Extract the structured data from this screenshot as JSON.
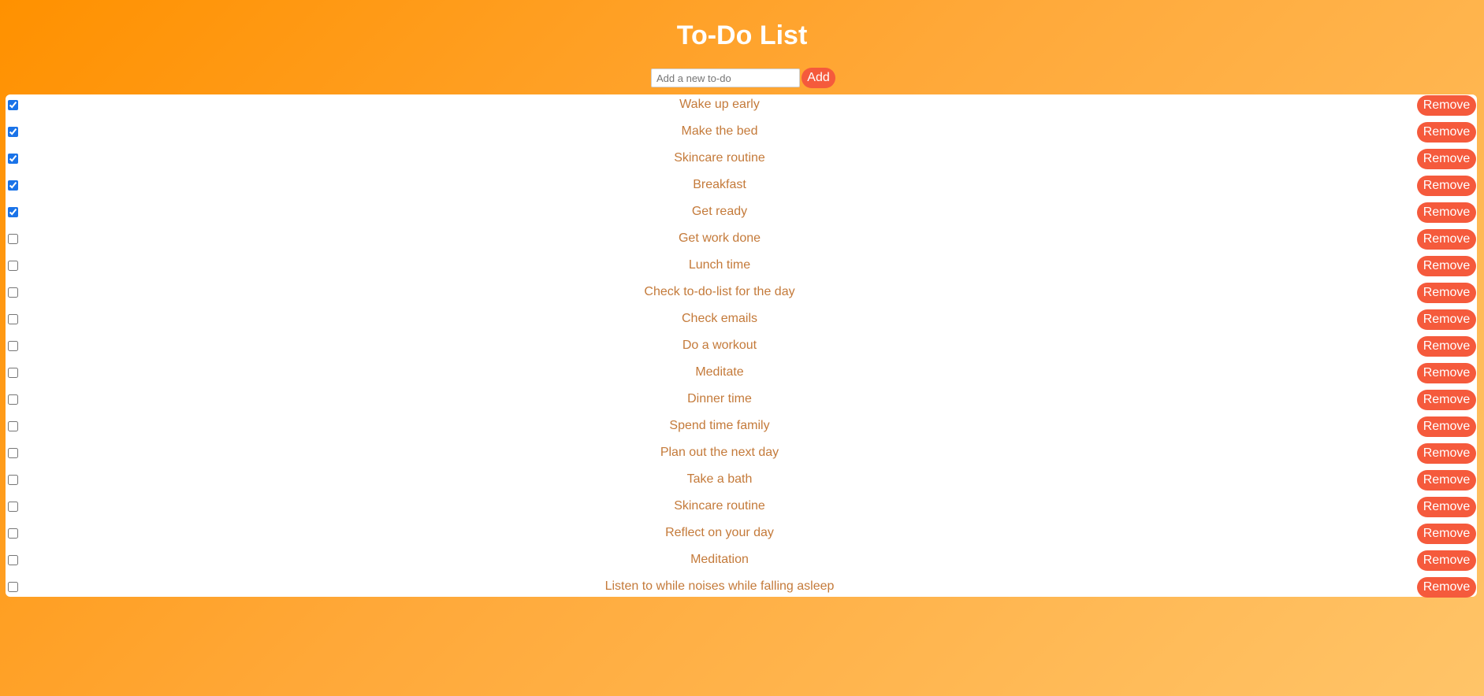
{
  "app": {
    "title": "To-Do List"
  },
  "add_form": {
    "placeholder": "Add a new to-do",
    "value": "",
    "button_label": "Add"
  },
  "todos": [
    {
      "text": "Wake up early",
      "done": true,
      "remove_label": "Remove"
    },
    {
      "text": "Make the bed",
      "done": true,
      "remove_label": "Remove"
    },
    {
      "text": "Skincare routine",
      "done": true,
      "remove_label": "Remove"
    },
    {
      "text": "Breakfast",
      "done": true,
      "remove_label": "Remove"
    },
    {
      "text": "Get ready",
      "done": true,
      "remove_label": "Remove"
    },
    {
      "text": "Get work done",
      "done": false,
      "remove_label": "Remove"
    },
    {
      "text": "Lunch time",
      "done": false,
      "remove_label": "Remove"
    },
    {
      "text": "Check to-do-list for the day",
      "done": false,
      "remove_label": "Remove"
    },
    {
      "text": "Check emails",
      "done": false,
      "remove_label": "Remove"
    },
    {
      "text": "Do a workout",
      "done": false,
      "remove_label": "Remove"
    },
    {
      "text": "Meditate",
      "done": false,
      "remove_label": "Remove"
    },
    {
      "text": "Dinner time",
      "done": false,
      "remove_label": "Remove"
    },
    {
      "text": "Spend time family",
      "done": false,
      "remove_label": "Remove"
    },
    {
      "text": "Plan out the next day",
      "done": false,
      "remove_label": "Remove"
    },
    {
      "text": "Take a bath",
      "done": false,
      "remove_label": "Remove"
    },
    {
      "text": "Skincare routine",
      "done": false,
      "remove_label": "Remove"
    },
    {
      "text": "Reflect on your day",
      "done": false,
      "remove_label": "Remove"
    },
    {
      "text": "Meditation",
      "done": false,
      "remove_label": "Remove"
    },
    {
      "text": "Listen to while noises while falling asleep",
      "done": false,
      "remove_label": "Remove"
    }
  ],
  "colors": {
    "background_start": "#ff9100",
    "background_end": "#ffc468",
    "accent_button": "#f55a3c",
    "item_text": "#c47a3a",
    "checkbox": "#1a73e8"
  }
}
